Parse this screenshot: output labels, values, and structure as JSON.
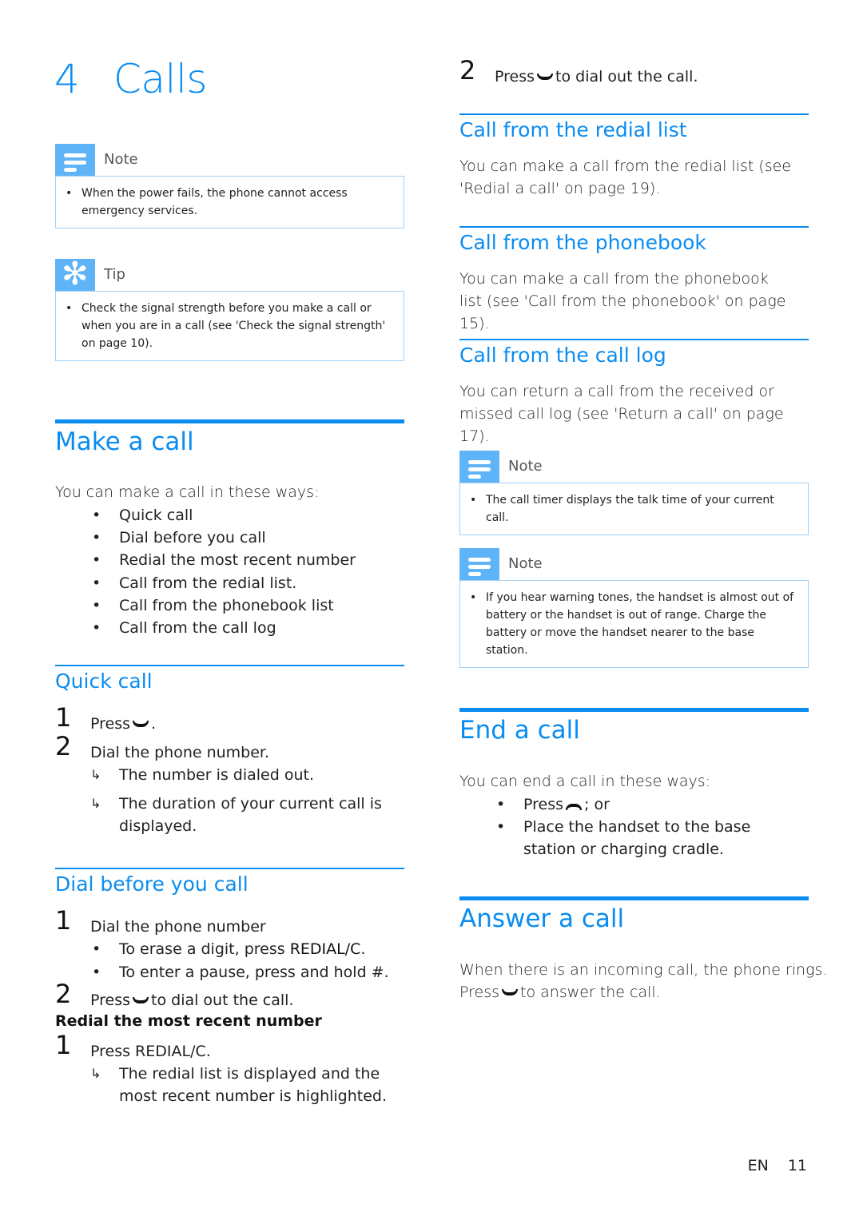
{
  "chapter": {
    "number": "4",
    "title": "Calls"
  },
  "left": {
    "note1": {
      "label": "Note",
      "icon": "note-icon",
      "items": [
        "When the power fails, the phone cannot access emergency services."
      ]
    },
    "tip": {
      "label": "Tip",
      "icon": "tip-asterisk-icon",
      "items": [
        "Check the signal strength before you make a call or when you are in a call (see 'Check the signal strength' on page 10)."
      ]
    },
    "make_call": {
      "heading": "Make a call",
      "intro": "You can make a call in these ways:",
      "ways": [
        "Quick call",
        "Dial before you call",
        "Redial the most recent number",
        "Call from the redial list.",
        "Call from the phonebook list",
        "Call from the call log"
      ]
    },
    "quick_call": {
      "heading": "Quick call",
      "step1": {
        "num": "1",
        "text_before": "Press",
        "icon": "call-icon",
        "text_after": "."
      },
      "step2": {
        "num": "2",
        "text": "Dial the phone number."
      },
      "results": [
        "The number is dialed out.",
        "The duration of your current call is displayed."
      ]
    },
    "dial_before": {
      "heading": "Dial before you call",
      "step1": {
        "num": "1",
        "text": "Dial the phone number"
      },
      "bullets": [
        {
          "text": "To erase a digit, press ",
          "key": "REDIAL/C",
          "end": "."
        },
        {
          "text": "To enter a pause, press and hold #."
        }
      ],
      "step2": {
        "num": "2",
        "text_before": "Press",
        "icon": "call-icon",
        "text_after": "to dial out the call."
      }
    },
    "redial": {
      "heading": "Redial the most recent number",
      "step1": {
        "num": "1",
        "text_before": "Press ",
        "key": "REDIAL/C",
        "text_after": "."
      },
      "result": "The redial list is displayed and the most recent number is highlighted."
    }
  },
  "right": {
    "redial_cont": {
      "num": "2",
      "text_before": "Press",
      "icon": "call-icon",
      "text_after": "to dial out the call."
    },
    "from_redial": {
      "heading": "Call from the redial list",
      "text": "You can make a call from the redial list (see 'Redial a call' on page 19)."
    },
    "from_phonebook": {
      "heading": "Call from the phonebook",
      "text": "You can make a call from the phonebook list (see 'Call from the phonebook' on page 15)."
    },
    "from_log": {
      "heading": "Call from the call log",
      "text": "You can return a call from the received or missed call log (see 'Return a call' on page 17)."
    },
    "note2": {
      "label": "Note",
      "items": [
        "The call timer displays the talk time of your current call."
      ]
    },
    "note3": {
      "label": "Note",
      "items": [
        "If you hear warning tones, the handset is almost out of battery or the handset is out of range. Charge the battery or move the handset nearer to the base station."
      ]
    },
    "end_call": {
      "heading": "End a call",
      "intro": "You can end a call in these ways:",
      "ways": [
        {
          "text_before": "Press",
          "icon": "end-call-icon",
          "text_after": "; or"
        },
        {
          "text": "Place the handset to the base station or charging cradle."
        }
      ]
    },
    "answer_call": {
      "heading": "Answer a call",
      "line1": "When there is an incoming call, the phone rings.",
      "line2_before": "Press",
      "icon": "call-icon",
      "line2_after": "to answer the call."
    }
  },
  "footer": {
    "lang": "EN",
    "page": "11"
  },
  "colors": {
    "accent": "#0a8cf0",
    "note_icon_bg": "#5fb4f7",
    "note_border": "#9fd0f7"
  }
}
